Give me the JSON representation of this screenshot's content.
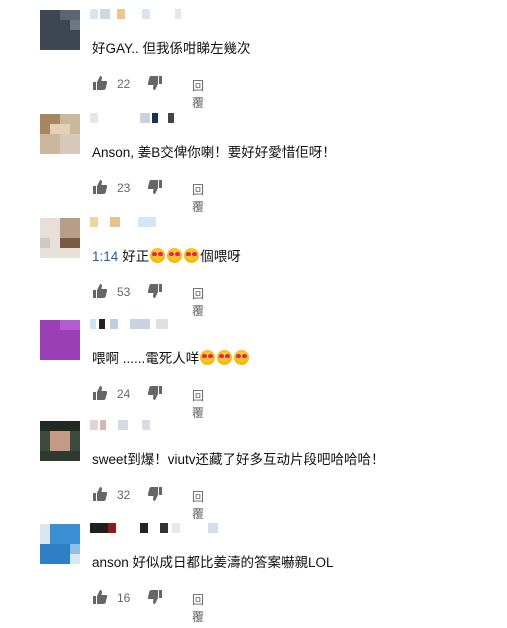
{
  "comments": [
    {
      "text": "好GAY.. 但我係咁睇左幾次",
      "likes": "22",
      "reply": "回覆"
    },
    {
      "text": "Anson, 姜B交俾你喇！要好好愛惜佢呀！",
      "likes": "23",
      "reply": "回覆"
    },
    {
      "timestamp": "1:14",
      "text_a": "好正",
      "text_b": "個喂呀",
      "likes": "53",
      "reply": "回覆"
    },
    {
      "text": "喂啊 ......電死人咩",
      "likes": "24",
      "reply": "回覆"
    },
    {
      "text": "sweet到爆！viutv还藏了好多互动片段吧哈哈哈！",
      "likes": "32",
      "reply": "回覆"
    },
    {
      "text": "anson 好似成日都比姜濤的答案嚇親LOL",
      "likes": "16",
      "reply": "回覆"
    }
  ],
  "colors": {
    "timestamp_link": "#1a5fb4",
    "meta_text": "#666666",
    "emoji_heart": "#e0245e"
  },
  "icons": [
    "thumbs-up-icon",
    "thumbs-down-icon",
    "heart-eyes-emoji"
  ]
}
